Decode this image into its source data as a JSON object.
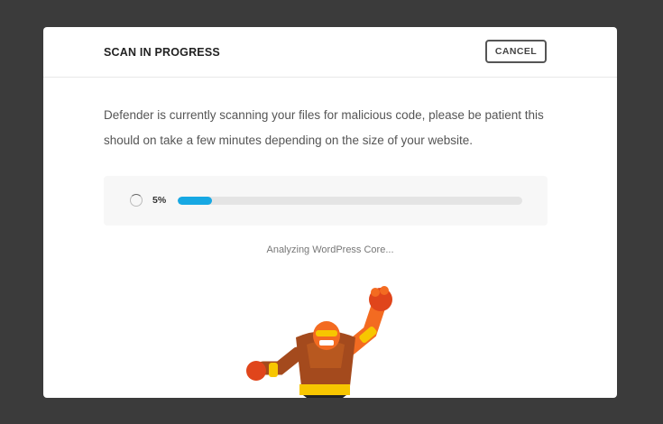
{
  "modal": {
    "title": "SCAN IN PROGRESS",
    "cancel_label": "CANCEL",
    "description": "Defender is currently scanning your files for malicious code, please be patient this should on take a few minutes depending on the size of your website.",
    "progress": {
      "percent_label": "5%",
      "value": 5,
      "fill_color": "#17a8e3"
    },
    "status_text": "Analyzing WordPress Core...",
    "mascot_icon": "defender-wrestler-mascot"
  },
  "colors": {
    "background": "#3b3b3b",
    "accent": "#17a8e3"
  }
}
